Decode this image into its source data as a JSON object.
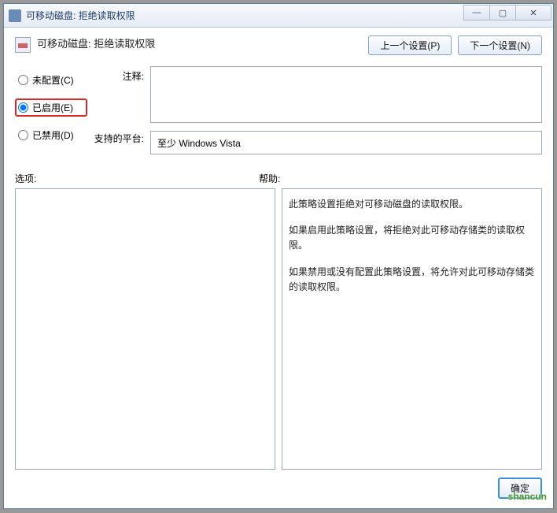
{
  "titlebar": {
    "title": "可移动磁盘: 拒绝读取权限"
  },
  "winbtns": {
    "min": "—",
    "max": "▢",
    "close": "✕"
  },
  "header": {
    "title": "可移动磁盘: 拒绝读取权限",
    "prev": "上一个设置(P)",
    "next": "下一个设置(N)"
  },
  "radios": {
    "notconf": "未配置(C)",
    "enabled": "已启用(E)",
    "disabled": "已禁用(D)"
  },
  "labels": {
    "comment": "注释:",
    "platform": "支持的平台:",
    "options": "选项:",
    "help": "帮助:"
  },
  "fields": {
    "comment_value": "",
    "platform_value": "至少 Windows Vista"
  },
  "help": {
    "p1": "此策略设置拒绝对可移动磁盘的读取权限。",
    "p2": "如果启用此策略设置，将拒绝对此可移动存储类的读取权限。",
    "p3": "如果禁用或没有配置此策略设置，将允许对此可移动存储类的读取权限。"
  },
  "footer": {
    "ok": "确定"
  },
  "watermark": {
    "brand": "shancun"
  }
}
